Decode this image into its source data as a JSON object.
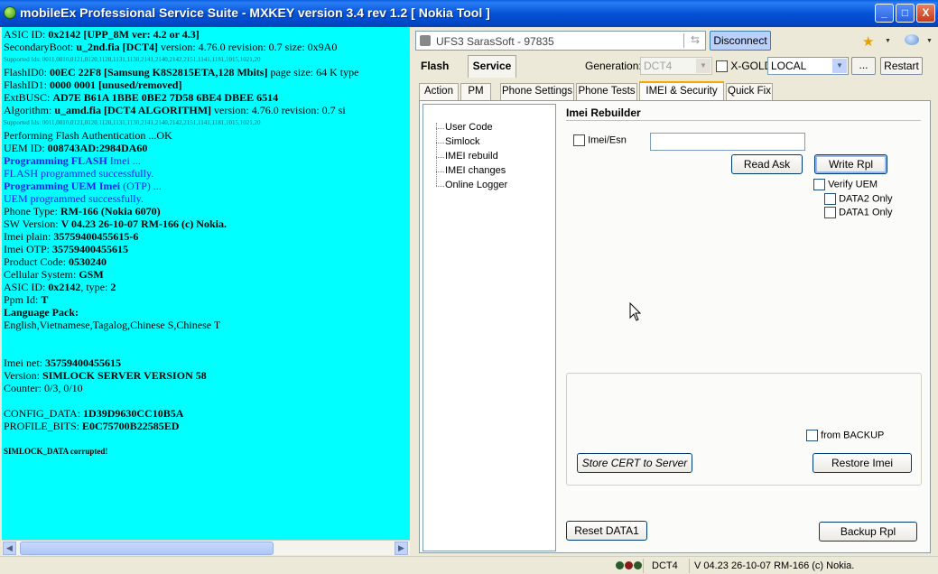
{
  "window": {
    "title": "mobileEx Professional Service Suite - MXKEY version 3.4 rev 1.2  [ Nokia Tool ]",
    "controls": {
      "minimize": "_",
      "maximize": "□",
      "close": "X"
    }
  },
  "log": [
    {
      "text": "ASIC ID: ",
      "bold": "0x2142 [UPP_8M ver: 4.2 or 4.3]"
    },
    {
      "text": " SecondaryBoot: ",
      "bold": "u_2nd.fia [DCT4]",
      "rest": " version: 4.76.0 revision: 0.7 size: 0x9A0"
    },
    {
      "small": "Supported Ids: 0011,0010,0121,0120,1120,1131,1130,2141,2140,2142,2151,1141,1181,1015,1021,20"
    },
    {
      "text": "FlashID0: ",
      "bold": "00EC 22F8 [Samsung K8S2815ETA,128 Mbits]",
      "rest": " page size: 64 K type"
    },
    {
      "text": "FlashID1: ",
      "bold": "0000 0001 [unused/removed]"
    },
    {
      "text": "ExtBUSC: ",
      "bold": "AD7E B61A 1BBE 0BE2 7D58 6BE4 DBEE 6514"
    },
    {
      "text": " Algorithm: ",
      "bold": "u_amd.fia [DCT4 ALGORITHM]",
      "rest": " version: 4.76.0 revision: 0.7 si"
    },
    {
      "small": "Supported Ids: 0011,0010,0121,0120,1120,1131,1130,2141,2140,2142,2151,1141,1181,1015,1021,20"
    },
    {
      "text": "Performing Flash Authentication ...OK"
    },
    {
      "text": "UEM ID: ",
      "bold": "008743AD:2984DA60"
    },
    {
      "blue_bold": "Programming FLASH",
      "blue": " Imei ..."
    },
    {
      "blue": "FLASH programmed successfully."
    },
    {
      "blue_bold": "Programming UEM Imei",
      "blue": " (OTP) ..."
    },
    {
      "blue": "UEM programmed successfully."
    },
    {
      "text": "Phone Type: ",
      "bold": "RM-166 (Nokia 6070)"
    },
    {
      "text": "SW Version: ",
      "bold": "V 04.23 26-10-07 RM-166 (c) Nokia."
    },
    {
      "text": "Imei plain: ",
      "bold": "35759400455615-6"
    },
    {
      "text": "Imei OTP: ",
      "bold": "35759400455615"
    },
    {
      "text": "Product Code: ",
      "bold": "0530240"
    },
    {
      "text": "Cellular System: ",
      "bold": "GSM"
    },
    {
      "text": "ASIC ID: ",
      "bold": "0x2142",
      "rest": ", type: ",
      "bold2": "2"
    },
    {
      "text": "Ppm Id: ",
      "bold": "T"
    },
    {
      "text": "",
      "bold": "Language Pack:"
    },
    {
      "text": "English,Vietnamese,Tagalog,Chinese S,Chinese T"
    },
    {
      "text": ""
    },
    {
      "text": ""
    },
    {
      "text": "Imei net: ",
      "bold": "35759400455615"
    },
    {
      "text": "Version: ",
      "bold": "SIMLOCK SERVER VERSION 58"
    },
    {
      "text": "Counter: 0/3, 0/10"
    },
    {
      "text": ""
    },
    {
      "text": "CONFIG_DATA: ",
      "bold": "1D39D9630CC10B5A"
    },
    {
      "text": "PROFILE_BITS: ",
      "bold": "E0C75700B22585ED"
    },
    {
      "text": ""
    },
    {
      "tiny": "SIMLOCK_DATA corrupted!"
    }
  ],
  "connection": {
    "interface": "UFS3 SarasSoft - 97835",
    "disconnect_label": "Disconnect"
  },
  "mode_tabs": {
    "flash": "Flash",
    "service": "Service"
  },
  "generation": {
    "label": "Generation:",
    "value": "DCT4"
  },
  "xgold_label": "X-GOLD",
  "local_value": "LOCAL",
  "dots_label": "...",
  "restart_label": "Restart",
  "sub_tabs": [
    "Action",
    "PM",
    "Phone Settings",
    "Phone Tests",
    "IMEI & Security",
    "Quick Fix"
  ],
  "tree_items": [
    "User Code",
    "Simlock",
    "IMEI rebuild",
    "IMEI changes",
    "Online Logger"
  ],
  "imei_rebuilder": {
    "title": "Imei Rebuilder",
    "imei_esn_label": "Imei/Esn",
    "imei_value": "",
    "read_ask": "Read Ask",
    "write_rpl": "Write Rpl",
    "verify_uem": "Verify UEM",
    "data2_only": "DATA2 Only",
    "data1_only": "DATA1 Only",
    "from_backup": "from BACKUP",
    "store_cert": "Store CERT to Server",
    "restore_imei": "Restore Imei",
    "reset_data1": "Reset DATA1",
    "backup_rpl": "Backup Rpl"
  },
  "status": {
    "generation": "DCT4",
    "version": "V 04.23 26-10-07 RM-166 (c) Nokia."
  }
}
